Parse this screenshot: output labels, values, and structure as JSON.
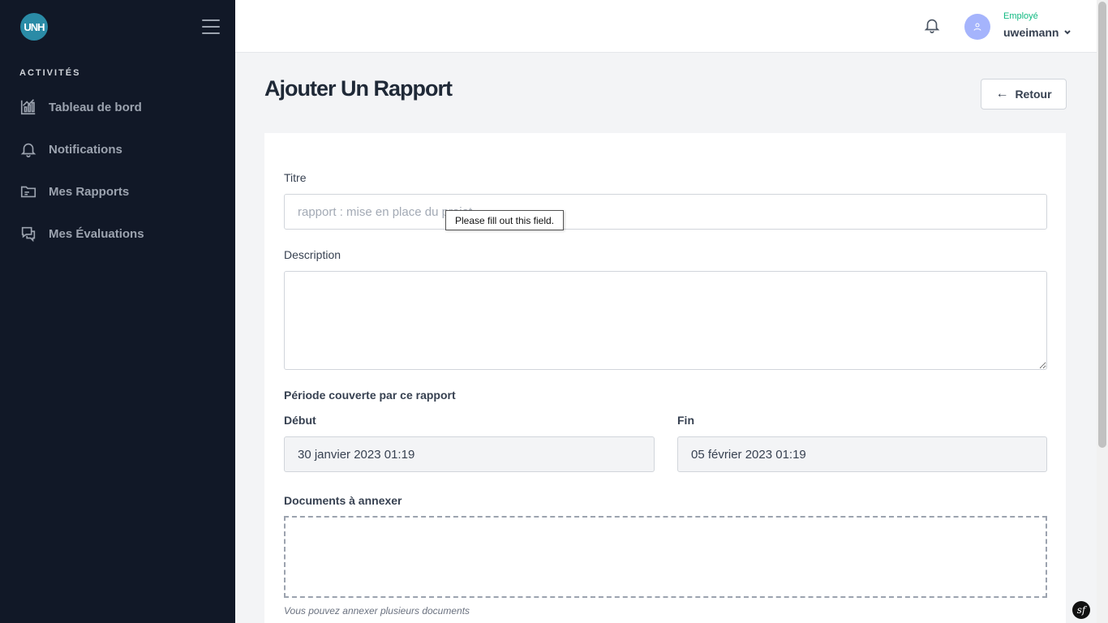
{
  "sidebar": {
    "logo_text": "UNH",
    "section_title": "ACTIVITÉS",
    "items": [
      {
        "label": "Tableau de bord",
        "icon": "chart-icon"
      },
      {
        "label": "Notifications",
        "icon": "bell-icon"
      },
      {
        "label": "Mes Rapports",
        "icon": "folder-icon"
      },
      {
        "label": "Mes Évaluations",
        "icon": "chat-icon"
      }
    ]
  },
  "header": {
    "role": "Employé",
    "username": "uweimann"
  },
  "main": {
    "title": "Ajouter Un Rapport",
    "back_label": "Retour",
    "form": {
      "titre_label": "Titre",
      "titre_placeholder": "rapport : mise en place du projet",
      "description_label": "Description",
      "periode_label": "Période couverte par ce rapport",
      "debut_label": "Début",
      "debut_value": "30 janvier 2023 01:19",
      "fin_label": "Fin",
      "fin_value": "05 février 2023 01:19",
      "documents_label": "Documents à annexer",
      "documents_help": "Vous pouvez annexer plusieurs documents"
    },
    "tooltip": "Please fill out this field."
  },
  "symfony_badge": "sf",
  "colors": {
    "sidebar_bg": "#111827",
    "accent_green": "#10b981",
    "logo_bg": "#2a8ba6",
    "avatar_bg": "#a5b4fc"
  }
}
